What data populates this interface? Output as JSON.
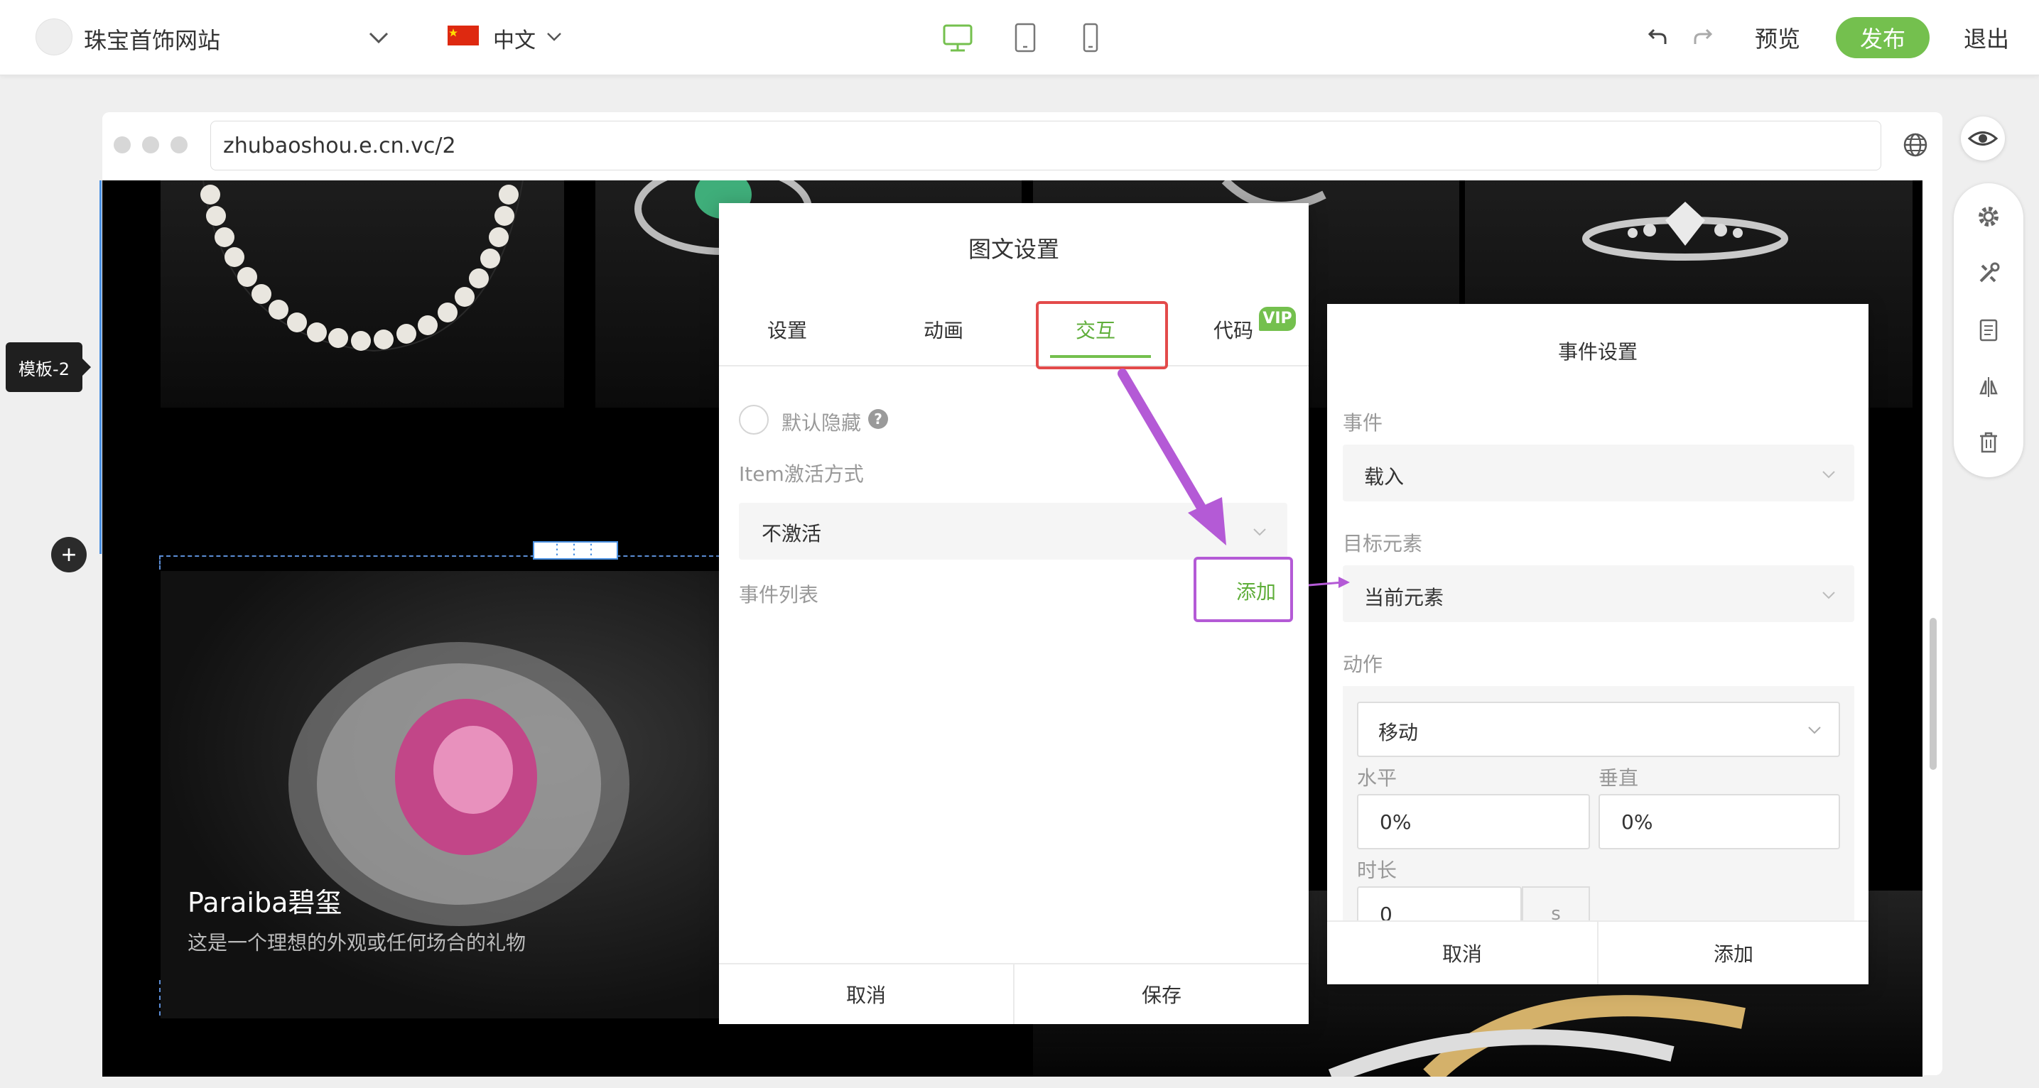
{
  "header": {
    "site_name": "珠宝首饰网站",
    "language": "中文",
    "preview_label": "预览",
    "publish_label": "发布",
    "exit_label": "退出"
  },
  "browser": {
    "url": "zhubaoshou.e.cn.vc/2"
  },
  "canvas": {
    "template_tag": "模板-2",
    "add_symbol": "+",
    "drag_handle": "⋮⋮⋮",
    "ring_title": "Paraiba碧玺",
    "ring_desc": "这是一个理想的外观或任何场合的礼物"
  },
  "graphic_dialog": {
    "title": "图文设置",
    "tabs": [
      {
        "label": "设置"
      },
      {
        "label": "动画"
      },
      {
        "label": "交互"
      },
      {
        "label": "代码"
      }
    ],
    "vip_badge": "VIP",
    "default_hidden_label": "默认隐藏",
    "help_symbol": "?",
    "activation_label": "Item激活方式",
    "activation_value": "不激活",
    "event_list_label": "事件列表",
    "add_label": "添加",
    "cancel_label": "取消",
    "save_label": "保存"
  },
  "event_panel": {
    "title": "事件设置",
    "event_label": "事件",
    "event_value": "载入",
    "target_label": "目标元素",
    "target_value": "当前元素",
    "action_label": "动作",
    "action_value": "移动",
    "horizontal_label": "水平",
    "horizontal_value": "0%",
    "vertical_label": "垂直",
    "vertical_value": "0%",
    "duration_label": "时长",
    "duration_value": "0",
    "duration_unit": "s",
    "cancel_label": "取消",
    "add_label": "添加"
  },
  "colors": {
    "accent_green": "#74c04e",
    "highlight_red": "#e34a4a",
    "highlight_purple": "#b45ad6"
  }
}
